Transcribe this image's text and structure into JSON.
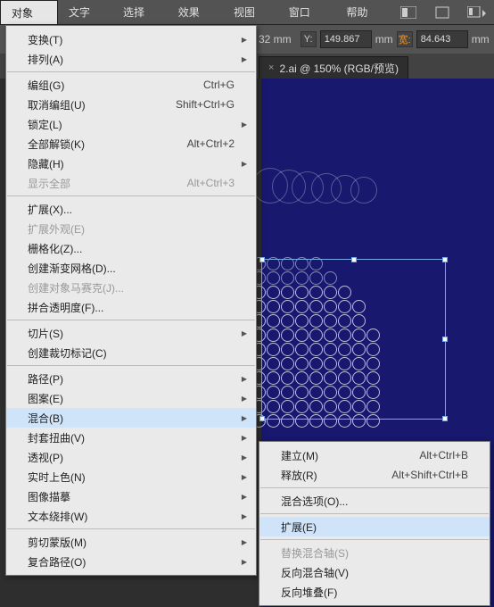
{
  "menubar": {
    "items": [
      "对象(O)",
      "文字(T)",
      "选择(S)",
      "效果(C)",
      "视图(V)",
      "窗口(W)",
      "帮助(H)"
    ]
  },
  "toolbar": {
    "y_label": "Y:",
    "y_value": "149.867",
    "kuan_label": "宽:",
    "kuan_value": "84.643",
    "suffix1": "32 mm",
    "suffix2": "mm",
    "suffix3": "mm"
  },
  "tab": {
    "title": "2.ai @ 150% (RGB/预览)",
    "close": "×"
  },
  "menu": {
    "transform": "变换(T)",
    "arrange": "排列(A)",
    "group": "编组(G)",
    "group_sc": "Ctrl+G",
    "ungroup": "取消编组(U)",
    "ungroup_sc": "Shift+Ctrl+G",
    "lock": "锁定(L)",
    "unlockall": "全部解锁(K)",
    "unlockall_sc": "Alt+Ctrl+2",
    "hide": "隐藏(H)",
    "showall": "显示全部",
    "showall_sc": "Alt+Ctrl+3",
    "expand": "扩展(X)...",
    "expand_app": "扩展外观(E)",
    "rasterize": "栅格化(Z)...",
    "gradmesh": "创建渐变网格(D)...",
    "mosaic": "创建对象马赛克(J)...",
    "flatten": "拼合透明度(F)...",
    "slice": "切片(S)",
    "cropmarks": "创建裁切标记(C)",
    "path": "路径(P)",
    "pattern": "图案(E)",
    "blend": "混合(B)",
    "envelope": "封套扭曲(V)",
    "perspective": "透视(P)",
    "livepaint": "实时上色(N)",
    "imgtrace": "图像描摹",
    "textwrap": "文本绕排(W)",
    "clipmask": "剪切蒙版(M)",
    "compound": "复合路径(O)"
  },
  "submenu": {
    "make": "建立(M)",
    "make_sc": "Alt+Ctrl+B",
    "release": "释放(R)",
    "release_sc": "Alt+Shift+Ctrl+B",
    "options": "混合选项(O)...",
    "expand": "扩展(E)",
    "replace": "替换混合轴(S)",
    "reverse": "反向混合轴(V)",
    "stack": "反向堆叠(F)"
  }
}
